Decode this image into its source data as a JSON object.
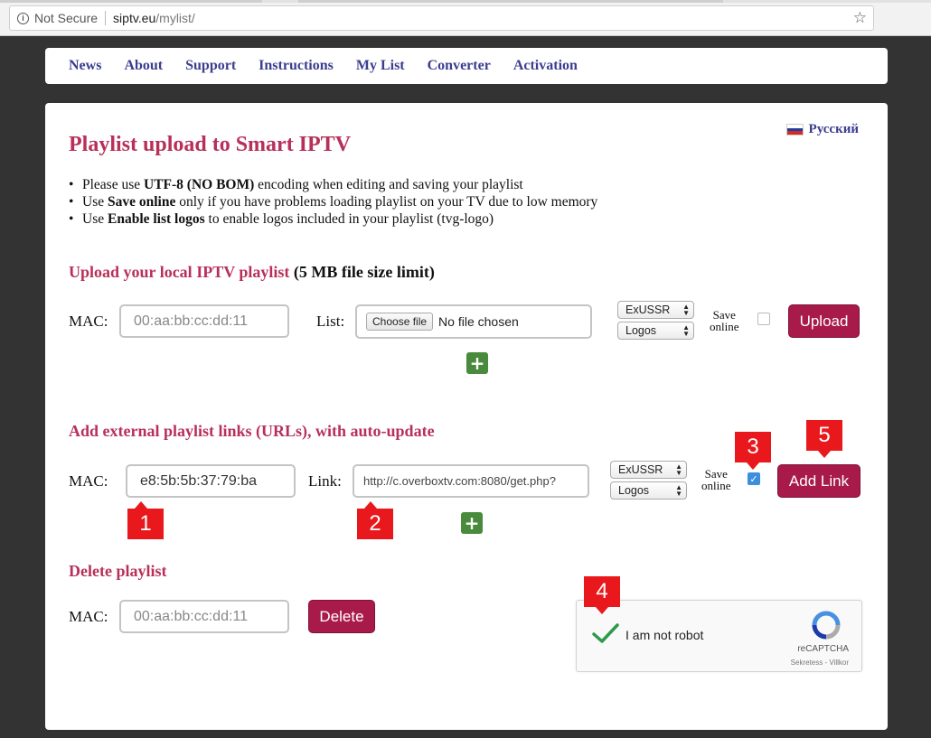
{
  "browser": {
    "security_label": "Not Secure",
    "url_host": "siptv.eu",
    "url_path": "/mylist/"
  },
  "nav": [
    "News",
    "About",
    "Support",
    "Instructions",
    "My List",
    "Converter",
    "Activation"
  ],
  "language": "Русский",
  "title": "Playlist upload to Smart IPTV",
  "bullets": [
    {
      "pre": "Please use ",
      "bold": "UTF-8 (NO BOM)",
      "post": " encoding when editing and saving your playlist"
    },
    {
      "pre": "Use ",
      "bold": "Save online",
      "post": " only if you have problems loading playlist on your TV due to low memory"
    },
    {
      "pre": "Use ",
      "bold": "Enable list logos",
      "post": " to enable logos included in your playlist (tvg-logo)"
    }
  ],
  "upload": {
    "heading": "Upload your local IPTV playlist",
    "heading_note": "(5 MB file size limit)",
    "mac_label": "MAC:",
    "mac_placeholder": "00:aa:bb:cc:dd:11",
    "list_label": "List:",
    "file_button": "Choose file",
    "file_status": "No file chosen",
    "region_select": "ExUSSR",
    "logos_select": "Logos",
    "save_online_line1": "Save",
    "save_online_line2": "online",
    "save_online_checked": false,
    "button": "Upload",
    "plus": "+"
  },
  "external": {
    "heading": "Add external playlist links (URLs), with auto-update",
    "mac_label": "MAC:",
    "mac_value": "e8:5b:5b:37:79:ba",
    "link_label": "Link:",
    "link_value": "http://c.overboxtv.com:8080/get.php?",
    "region_select": "ExUSSR",
    "logos_select": "Logos",
    "save_online_line1": "Save",
    "save_online_line2": "online",
    "save_online_checked": true,
    "button": "Add Link",
    "plus": "+"
  },
  "delete": {
    "heading": "Delete playlist",
    "mac_label": "MAC:",
    "mac_placeholder": "00:aa:bb:cc:dd:11",
    "button": "Delete"
  },
  "captcha": {
    "label": "I am not robot",
    "brand": "reCAPTCHA",
    "terms": "Sekretess - Villkor"
  },
  "callouts": [
    "1",
    "2",
    "3",
    "4",
    "5"
  ],
  "colors": {
    "heading": "#b8305a",
    "nav_link": "#3b3d8f",
    "button": "#a81a4a",
    "plus": "#4a8a3c",
    "callout": "#e8181c",
    "checkbox_on": "#3b8fdc"
  }
}
